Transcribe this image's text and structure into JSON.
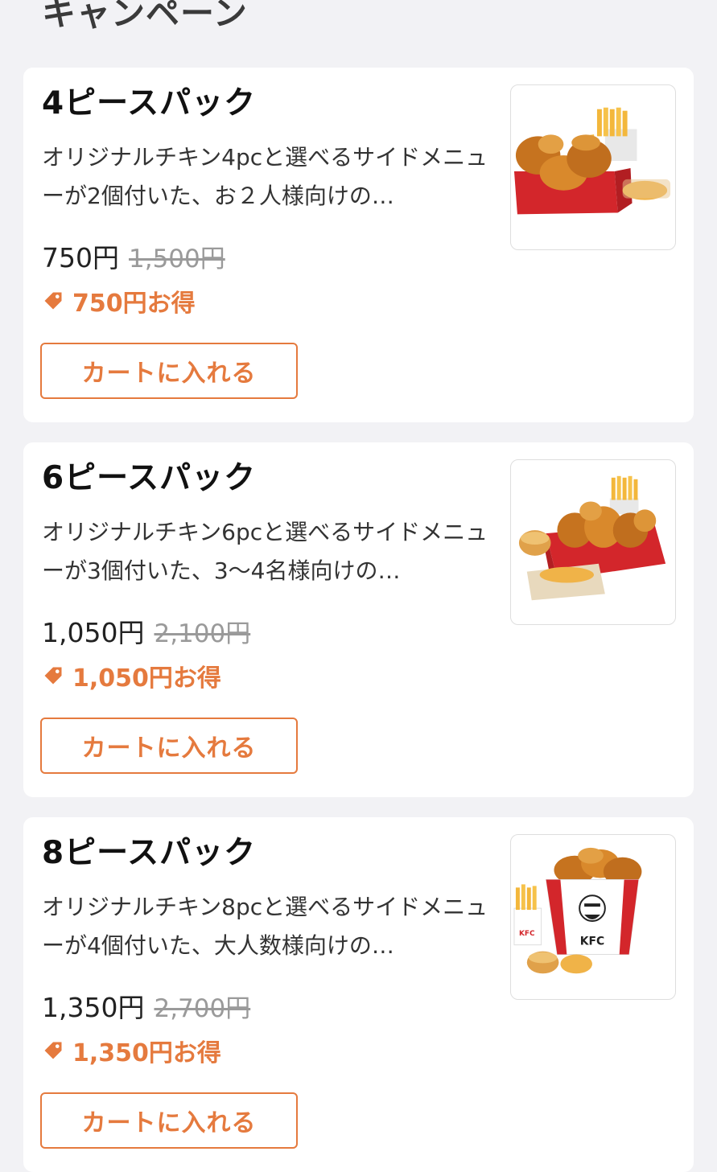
{
  "section": {
    "title": "キャンペーン"
  },
  "colors": {
    "accent": "#e57a3e",
    "background": "#f2f2f5",
    "card": "#ffffff"
  },
  "products": [
    {
      "title": "4ピースパック",
      "description": "オリジナルチキン4pcと選べるサイドメニューが2個付いた、お２人様向けの…",
      "price": "750円",
      "original_price": "1,500円",
      "discount": "750円お得",
      "cart_label": "カートに入れる",
      "image_icon": "chicken-box-with-fries"
    },
    {
      "title": "6ピースパック",
      "description": "オリジナルチキン6pcと選べるサイドメニューが3個付いた、3〜4名様向けの…",
      "price": "1,050円",
      "original_price": "2,100円",
      "discount": "1,050円お得",
      "cart_label": "カートに入れる",
      "image_icon": "chicken-box-with-biscuit"
    },
    {
      "title": "8ピースパック",
      "description": "オリジナルチキン8pcと選べるサイドメニューが4個付いた、大人数様向けの…",
      "price": "1,350円",
      "original_price": "2,700円",
      "discount": "1,350円お得",
      "cart_label": "カートに入れる",
      "image_icon": "chicken-bucket"
    }
  ]
}
